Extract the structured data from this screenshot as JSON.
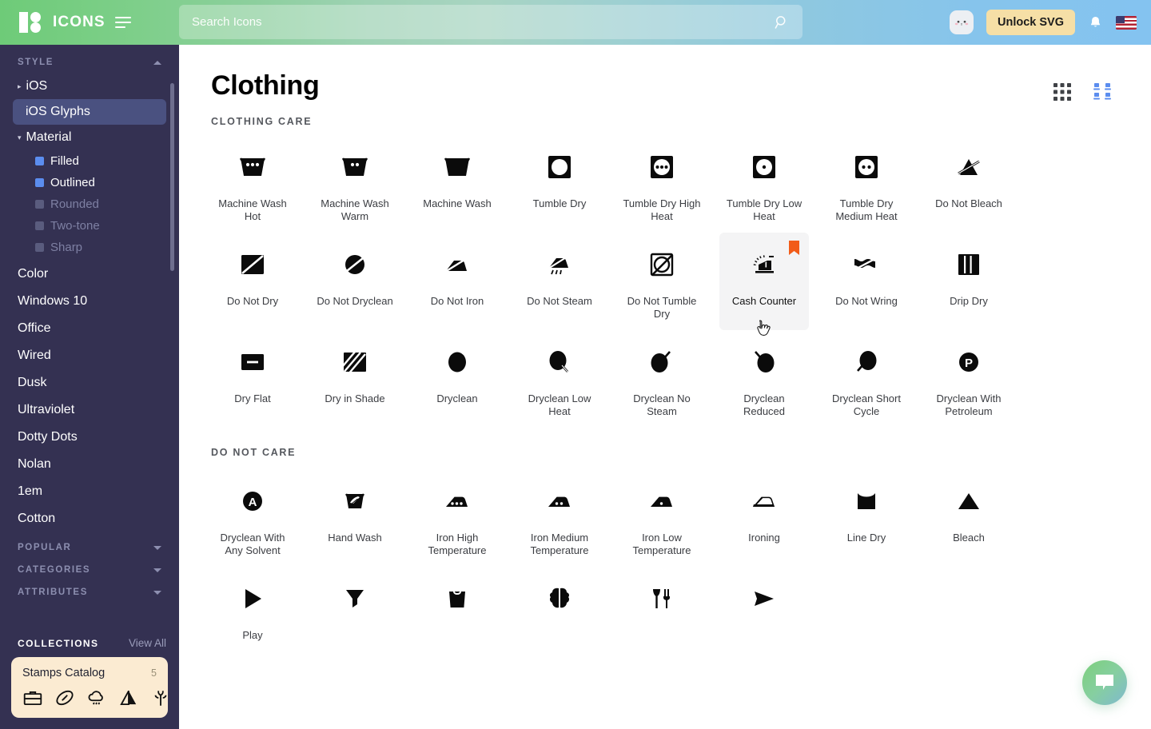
{
  "header": {
    "logo_text": "ICONS",
    "logo_icon": "brand-logo-icon",
    "menu_icon": "hamburger-menu-icon",
    "search_placeholder": "Search Icons",
    "search_value": "",
    "search_icon": "search-icon",
    "cat_icon": "cat-avatar-icon",
    "unlock_label": "Unlock SVG",
    "bell_icon": "notification-bell-icon",
    "flag_icon": "us-flag-icon",
    "gradient_start": "#6ecb78",
    "gradient_end": "#84c3f0",
    "unlock_bg": "#f6dfa6"
  },
  "sidebar": {
    "style": {
      "title": "STYLE",
      "collapsed": false,
      "items": [
        {
          "label": "iOS",
          "expandable": true,
          "expanded": false,
          "active": false
        },
        {
          "label": "iOS Glyphs",
          "expandable": false,
          "expanded": false,
          "active": true
        },
        {
          "label": "Material",
          "expandable": true,
          "expanded": true,
          "active": false
        }
      ],
      "material_children": [
        {
          "label": "Filled",
          "checked": true,
          "color": "#5b8def"
        },
        {
          "label": "Outlined",
          "checked": true,
          "color": "#5b8def"
        },
        {
          "label": "Rounded",
          "checked": false,
          "color": "#5a5c7e"
        },
        {
          "label": "Two-tone",
          "checked": false,
          "color": "#5a5c7e"
        },
        {
          "label": "Sharp",
          "checked": false,
          "color": "#5a5c7e"
        }
      ],
      "more_items": [
        "Color",
        "Windows 10",
        "Office",
        "Wired",
        "Dusk",
        "Ultraviolet",
        "Dotty Dots",
        "Nolan",
        "1em",
        "Cotton"
      ]
    },
    "groups": [
      {
        "title": "POPULAR",
        "collapsed": true
      },
      {
        "title": "CATEGORIES",
        "collapsed": true
      },
      {
        "title": "ATTRIBUTES",
        "collapsed": true
      }
    ],
    "collections": {
      "title": "COLLECTIONS",
      "view_all": "View All",
      "card": {
        "name": "Stamps Catalog",
        "count": "5",
        "bg": "#fbebd2",
        "icons": [
          "briefcase-icon",
          "football-icon",
          "rain-cloud-icon",
          "mountain-icon",
          "antler-icon"
        ]
      }
    }
  },
  "main": {
    "title": "Clothing",
    "view_grid_icon": "grid-view-icon",
    "view_card_icon": "card-view-icon",
    "active_view": "card",
    "accent": "#5b8def",
    "sections": [
      {
        "label": "CLOTHING CARE",
        "icons": [
          {
            "name": "Machine Wash Hot",
            "glyph": "machine-wash-hot-icon"
          },
          {
            "name": "Machine Wash Warm",
            "glyph": "machine-wash-warm-icon"
          },
          {
            "name": "Machine Wash",
            "glyph": "machine-wash-icon"
          },
          {
            "name": "Tumble Dry",
            "glyph": "tumble-dry-icon"
          },
          {
            "name": "Tumble Dry High Heat",
            "glyph": "tumble-dry-high-heat-icon"
          },
          {
            "name": "Tumble Dry Low Heat",
            "glyph": "tumble-dry-low-heat-icon"
          },
          {
            "name": "Tumble Dry Medium Heat",
            "glyph": "tumble-dry-medium-heat-icon"
          },
          {
            "name": "Do Not Bleach",
            "glyph": "do-not-bleach-icon"
          },
          {
            "name": "Do Not Dry",
            "glyph": "do-not-dry-icon"
          },
          {
            "name": "Do Not Dryclean",
            "glyph": "do-not-dryclean-icon"
          },
          {
            "name": "Do Not Iron",
            "glyph": "do-not-iron-icon"
          },
          {
            "name": "Do Not Steam",
            "glyph": "do-not-steam-icon"
          },
          {
            "name": "Do Not Tumble Dry",
            "glyph": "do-not-tumble-dry-icon"
          },
          {
            "name": "Cash Counter",
            "glyph": "cash-counter-icon",
            "hovered": true,
            "bookmarked": true
          },
          {
            "name": "Do Not Wring",
            "glyph": "do-not-wring-icon"
          },
          {
            "name": "Drip Dry",
            "glyph": "drip-dry-icon"
          },
          {
            "name": "Dry Flat",
            "glyph": "dry-flat-icon"
          },
          {
            "name": "Dry in Shade",
            "glyph": "dry-in-shade-icon"
          },
          {
            "name": "Dryclean",
            "glyph": "dryclean-icon"
          },
          {
            "name": "Dryclean Low Heat",
            "glyph": "dryclean-low-heat-icon"
          },
          {
            "name": "Dryclean No Steam",
            "glyph": "dryclean-no-steam-icon"
          },
          {
            "name": "Dryclean Reduced",
            "glyph": "dryclean-reduced-icon"
          },
          {
            "name": "Dryclean Short Cycle",
            "glyph": "dryclean-short-cycle-icon"
          },
          {
            "name": "Dryclean With Petroleum",
            "glyph": "dryclean-with-petroleum-icon"
          }
        ]
      },
      {
        "label": "DO NOT CARE",
        "icons": [
          {
            "name": "Dryclean With Any Solvent",
            "glyph": "dryclean-any-solvent-icon"
          },
          {
            "name": "Hand Wash",
            "glyph": "hand-wash-icon"
          },
          {
            "name": "Iron High Temperature",
            "glyph": "iron-high-temp-icon"
          },
          {
            "name": "Iron Medium Temperature",
            "glyph": "iron-medium-temp-icon"
          },
          {
            "name": "Iron Low Temperature",
            "glyph": "iron-low-temp-icon"
          },
          {
            "name": "Ironing",
            "glyph": "ironing-icon"
          },
          {
            "name": "Line Dry",
            "glyph": "line-dry-icon"
          },
          {
            "name": "Bleach",
            "glyph": "bleach-icon"
          },
          {
            "name": "Play",
            "glyph": "play-icon"
          },
          {
            "name": "",
            "glyph": "filter-funnel-icon"
          },
          {
            "name": "",
            "glyph": "shopping-bag-icon"
          },
          {
            "name": "",
            "glyph": "brain-icon"
          },
          {
            "name": "",
            "glyph": "restaurant-icon"
          },
          {
            "name": "",
            "glyph": "send-icon"
          }
        ]
      }
    ],
    "chat_icon": "chat-bubble-icon",
    "cursor_icon": "pointer-hand-cursor"
  }
}
